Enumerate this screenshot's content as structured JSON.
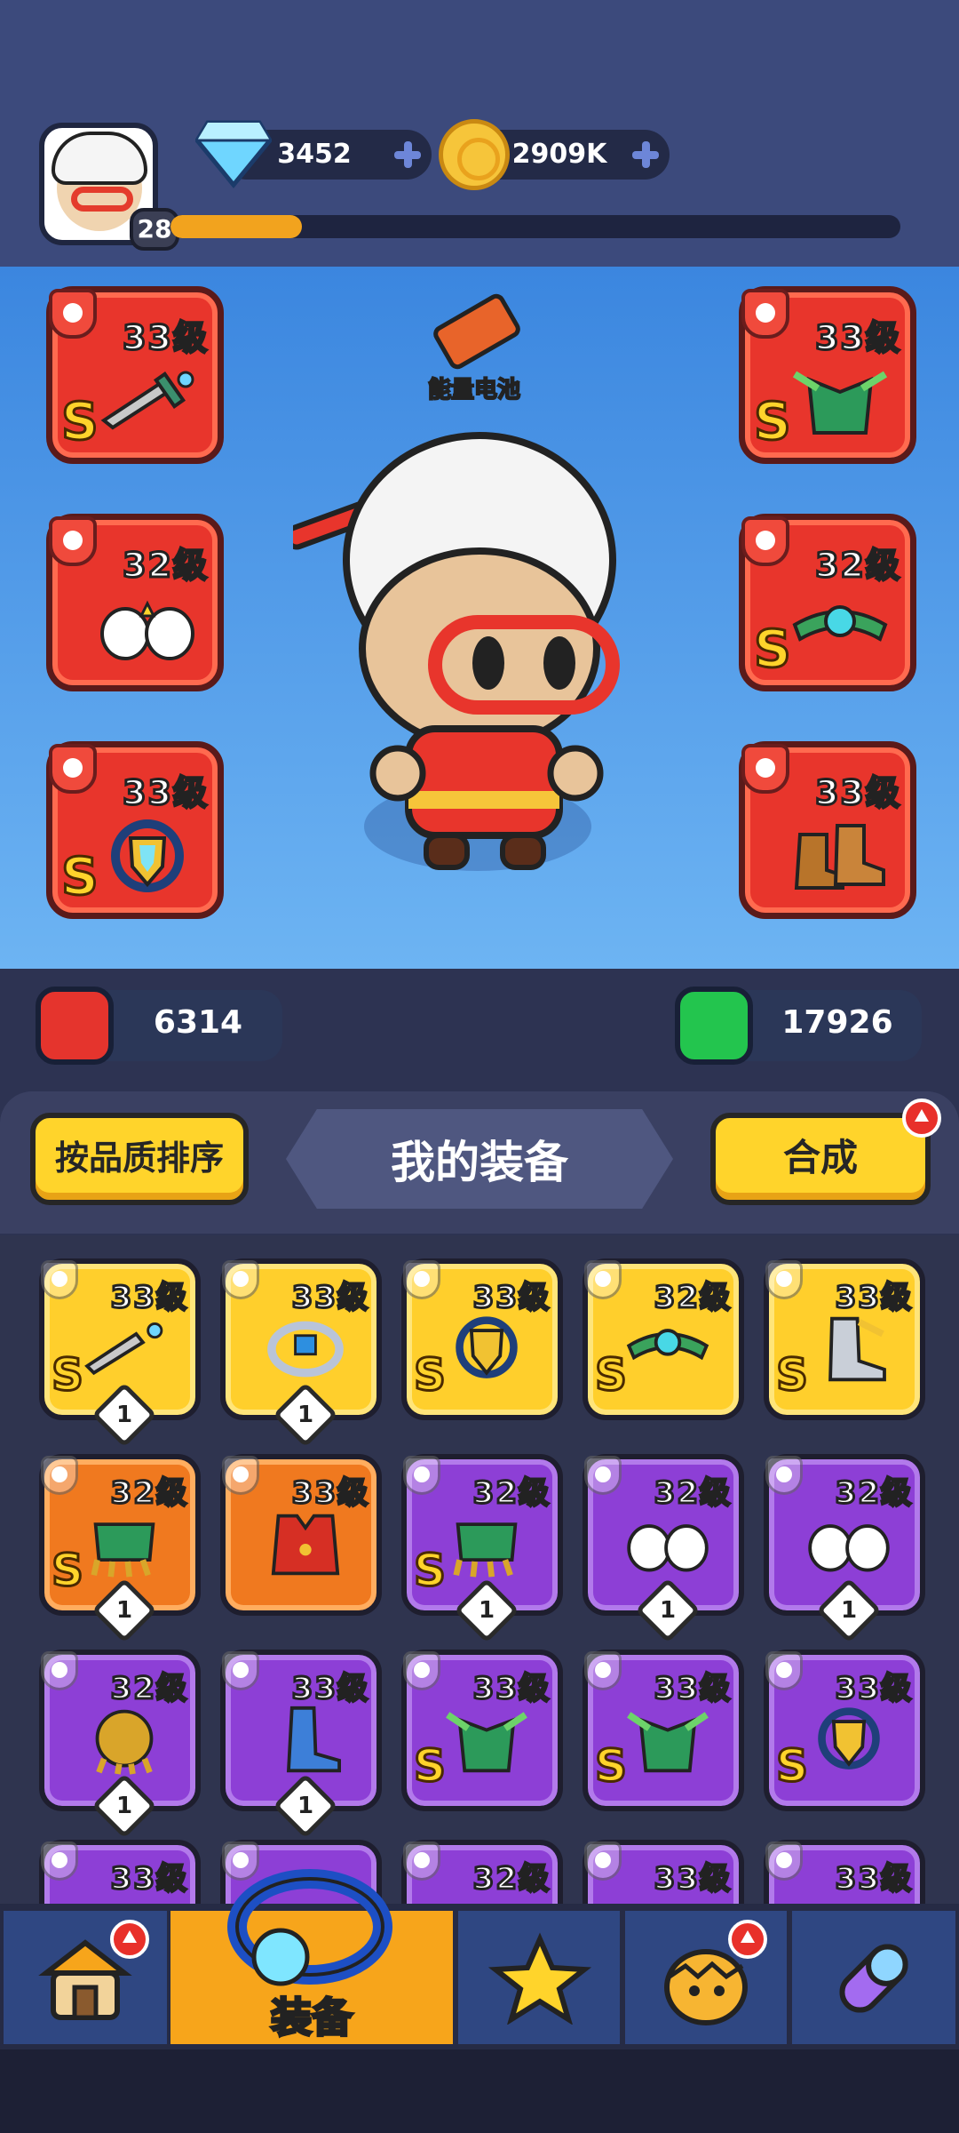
{
  "player": {
    "level": "28",
    "xp_fraction": 0.18
  },
  "currencies": {
    "gems": "3452",
    "coins": "2909K"
  },
  "hero": {
    "battery_label": "能量电池",
    "attack": "6314",
    "hp": "17926",
    "slots": [
      {
        "slot": "weapon",
        "level": "33级",
        "grade": "S",
        "icon": "dagger-icon"
      },
      {
        "slot": "armor",
        "level": "33级",
        "grade": "S",
        "icon": "leaf-armor-icon"
      },
      {
        "slot": "gloves",
        "level": "32级",
        "grade": "",
        "icon": "gloves-icon"
      },
      {
        "slot": "belt",
        "level": "32级",
        "grade": "S",
        "icon": "belt-icon"
      },
      {
        "slot": "ring",
        "level": "33级",
        "grade": "S",
        "icon": "shield-ring-icon"
      },
      {
        "slot": "boots",
        "level": "33级",
        "grade": "",
        "icon": "boots-icon"
      }
    ]
  },
  "inventory": {
    "sort_label": "按品质排序",
    "title": "我的装备",
    "merge_label": "合成",
    "items": [
      {
        "rarity": "gold",
        "level": "33级",
        "grade": "S",
        "count": "1",
        "icon": "dagger-icon"
      },
      {
        "rarity": "gold",
        "level": "33级",
        "grade": "",
        "count": "1",
        "icon": "ring-icon"
      },
      {
        "rarity": "gold",
        "level": "33级",
        "grade": "S",
        "count": "",
        "icon": "shield-ring-icon"
      },
      {
        "rarity": "gold",
        "level": "32级",
        "grade": "S",
        "count": "",
        "icon": "belt-icon"
      },
      {
        "rarity": "gold",
        "level": "33级",
        "grade": "S",
        "count": "",
        "icon": "leaf-boots-icon"
      },
      {
        "rarity": "orange",
        "level": "32级",
        "grade": "S",
        "count": "1",
        "icon": "claw-gloves-icon"
      },
      {
        "rarity": "orange",
        "level": "33级",
        "grade": "",
        "count": "",
        "icon": "vest-icon"
      },
      {
        "rarity": "purple",
        "level": "32级",
        "grade": "S",
        "count": "1",
        "icon": "claw-gloves-icon"
      },
      {
        "rarity": "purple",
        "level": "32级",
        "grade": "",
        "count": "1",
        "icon": "gloves-icon"
      },
      {
        "rarity": "purple",
        "level": "32级",
        "grade": "",
        "count": "1",
        "icon": "gloves-icon"
      },
      {
        "rarity": "purple",
        "level": "32级",
        "grade": "",
        "count": "1",
        "icon": "gold-gloves-icon"
      },
      {
        "rarity": "purple",
        "level": "33级",
        "grade": "",
        "count": "1",
        "icon": "blue-boots-icon"
      },
      {
        "rarity": "purple",
        "level": "33级",
        "grade": "S",
        "count": "",
        "icon": "leaf-armor-icon"
      },
      {
        "rarity": "purple",
        "level": "33级",
        "grade": "S",
        "count": "",
        "icon": "leaf-armor-icon"
      },
      {
        "rarity": "purple",
        "level": "33级",
        "grade": "S",
        "count": "",
        "icon": "shield-ring-icon"
      },
      {
        "rarity": "purple",
        "level": "33级",
        "grade": "",
        "count": "",
        "icon": "ring-icon"
      },
      {
        "rarity": "purple",
        "level": "",
        "grade": "",
        "count": "",
        "icon": "ring-icon"
      },
      {
        "rarity": "purple",
        "level": "32级",
        "grade": "",
        "count": "",
        "icon": "belt-icon"
      },
      {
        "rarity": "purple",
        "level": "33级",
        "grade": "",
        "count": "",
        "icon": "dagger-icon"
      },
      {
        "rarity": "purple",
        "level": "33级",
        "grade": "",
        "count": "",
        "icon": "dagger-icon"
      }
    ]
  },
  "nav": {
    "active_label": "装备",
    "items": [
      {
        "icon": "shop-house-icon"
      },
      {
        "icon": "equipment-ring-icon"
      },
      {
        "icon": "star-guns-icon"
      },
      {
        "icon": "pet-egg-icon"
      },
      {
        "icon": "capsule-icon"
      }
    ]
  },
  "colors": {
    "gold": "#ffcf2c",
    "orange": "#f0791f",
    "purple": "#8d3fd6",
    "red_slot": "#e8352c",
    "active_tab": "#f7a51b"
  }
}
